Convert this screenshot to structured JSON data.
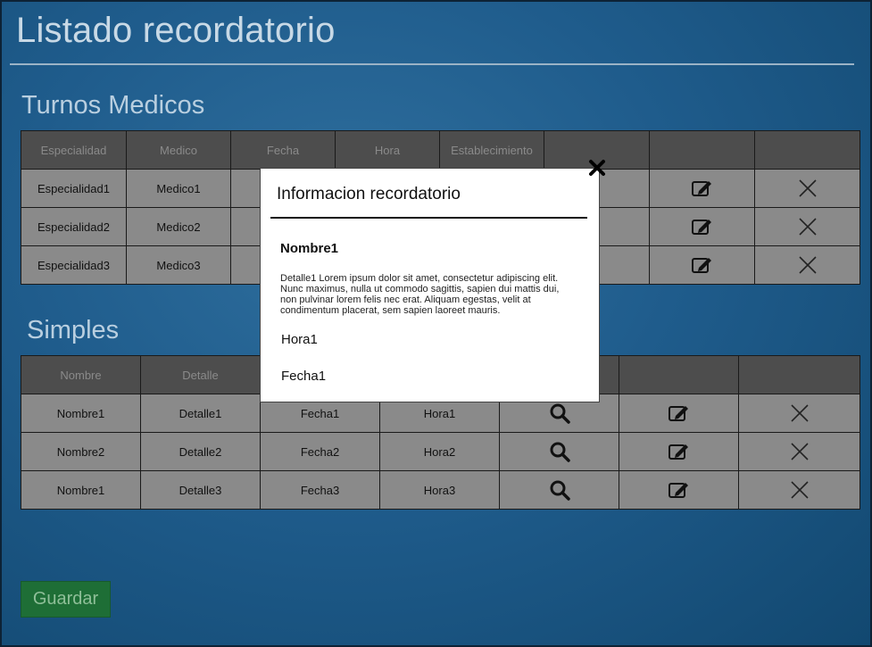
{
  "page": {
    "title": "Listado recordatorio"
  },
  "turnos": {
    "title": "Turnos Medicos",
    "headers": [
      "Especialidad",
      "Medico",
      "Fecha",
      "Hora",
      "Establecimiento"
    ],
    "rows": [
      {
        "especialidad": "Especialidad1",
        "medico": "Medico1"
      },
      {
        "especialidad": "Especialidad2",
        "medico": "Medico2"
      },
      {
        "especialidad": "Especialidad3",
        "medico": "Medico3"
      }
    ]
  },
  "simples": {
    "title": "Simples",
    "headers": [
      "Nombre",
      "Detalle"
    ],
    "rows": [
      {
        "nombre": "Nombre1",
        "detalle": "Detalle1",
        "fecha": "Fecha1",
        "hora": "Hora1"
      },
      {
        "nombre": "Nombre2",
        "detalle": "Detalle2",
        "fecha": "Fecha2",
        "hora": "Hora2"
      },
      {
        "nombre": "Nombre1",
        "detalle": "Detalle3",
        "fecha": "Fecha3",
        "hora": "Hora3"
      }
    ]
  },
  "actions": {
    "save_label": "Guardar"
  },
  "modal": {
    "title": "Informacion recordatorio",
    "name": "Nombre1",
    "detail": "Detalle1  Lorem ipsum dolor sit amet, consectetur adipiscing elit. Nunc maximus, nulla ut commodo sagittis, sapien dui mattis dui, non pulvinar lorem felis nec erat. Aliquam egestas, velit at condimentum placerat, sem sapien laoreet mauris.",
    "hora": "Hora1",
    "fecha": "Fecha1"
  },
  "icons": {
    "view": "search-icon",
    "edit": "edit-icon",
    "delete": "close-icon",
    "modal_close": "close-icon"
  },
  "colors": {
    "background": "#1f5c8c",
    "header_cell": "#4d4d4d",
    "body_cell": "#8a8a8a",
    "save_button": "#1e6e36"
  }
}
